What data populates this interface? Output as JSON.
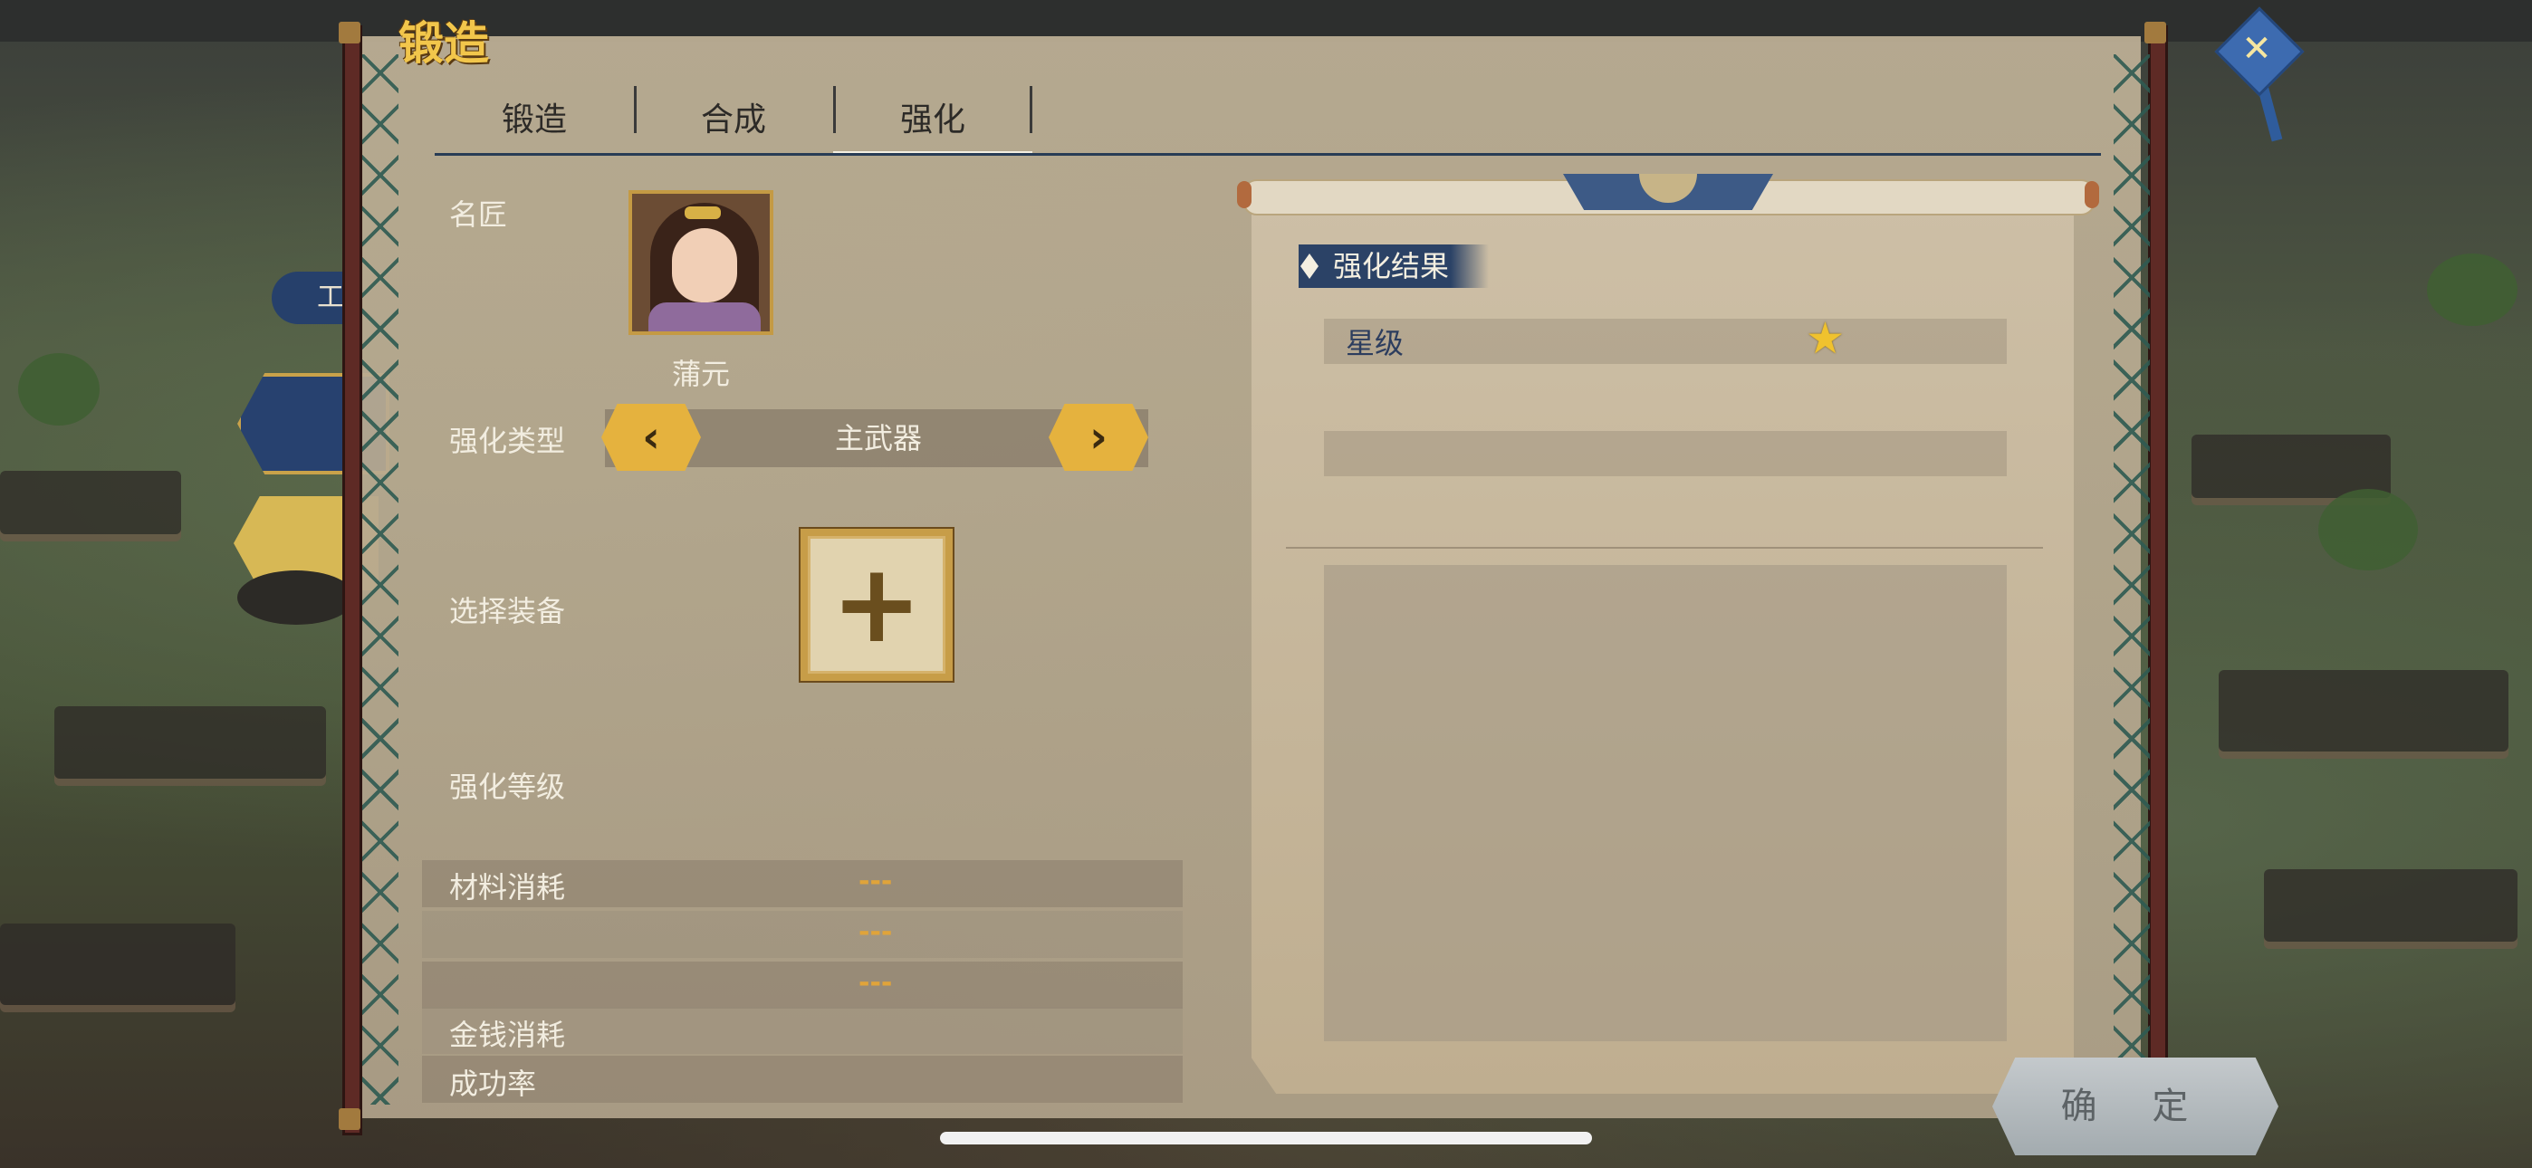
{
  "window": {
    "title": "锻造"
  },
  "tabs": [
    {
      "label": "锻造"
    },
    {
      "label": "合成"
    },
    {
      "label": "强化"
    }
  ],
  "active_tab": "强化",
  "side": {
    "partial_label": "工"
  },
  "left": {
    "craftsman_label": "名匠",
    "craftsman_name": "蒲元",
    "type_label": "强化类型",
    "type_value": "主武器",
    "prev_glyph": "‹",
    "next_glyph": "›",
    "select_label": "选择装备",
    "add_glyph": "+",
    "level_label": "强化等级",
    "material_label": "材料消耗",
    "materials": [
      "---",
      "---",
      "---"
    ],
    "money_label": "金钱消耗",
    "rate_label": "成功率"
  },
  "right": {
    "result_title": "强化结果",
    "star_label": "星级",
    "star_icon": "★"
  },
  "confirm_label": "确 定",
  "close_glyph": "✕",
  "colors": {
    "title_gold": "#f2c64b",
    "tab_line": "#283c55",
    "dash_orange": "#e0a43a",
    "result_blue": "#2b4266"
  }
}
